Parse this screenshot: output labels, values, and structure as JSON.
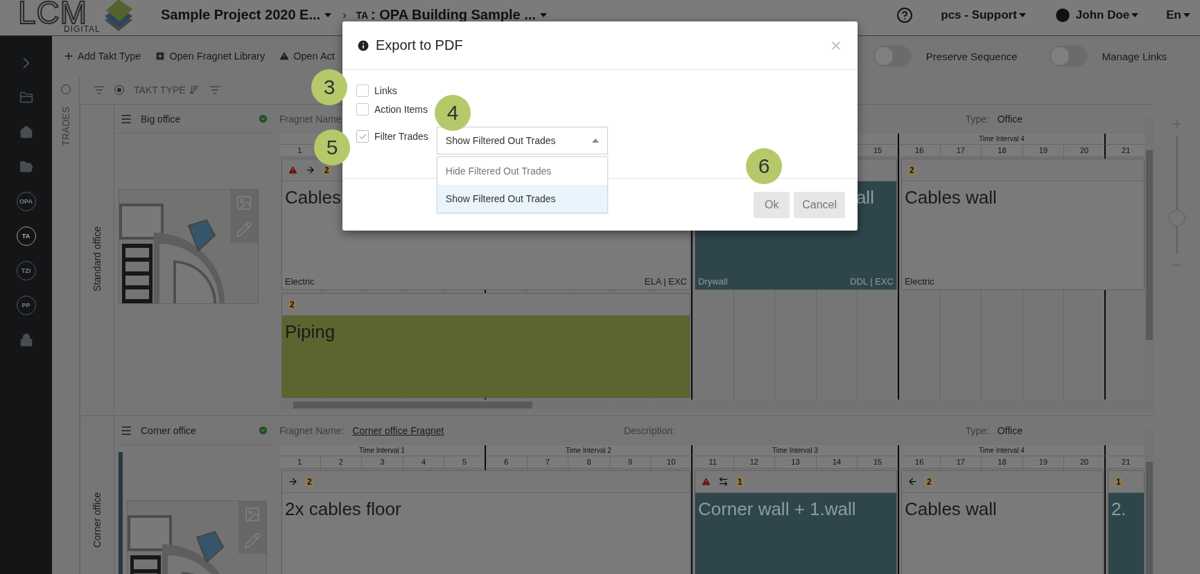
{
  "topbar": {
    "logo": {
      "text": "LCM",
      "subtext": "DIGITAL"
    },
    "project": "Sample Project 2020 E...",
    "separator": "›",
    "area_prefix": "TA",
    "area": ": OPA Building Sample ...",
    "account": "pcs - Support",
    "user": "John Doe",
    "language": "En"
  },
  "sidebar": {
    "items": [
      {
        "kind": "expand",
        "selected": false
      },
      {
        "kind": "folder",
        "selected": false
      },
      {
        "kind": "home",
        "selected": false
      },
      {
        "kind": "open-folder",
        "selected": false
      },
      {
        "kind": "badge",
        "label": "OPA",
        "selected": false
      },
      {
        "kind": "badge",
        "label": "TA",
        "selected": true
      },
      {
        "kind": "badge",
        "label": "TZI",
        "selected": false
      },
      {
        "kind": "badge",
        "label": "PP",
        "selected": false
      },
      {
        "kind": "lock",
        "selected": false
      }
    ]
  },
  "toolbar": {
    "actions": [
      {
        "kind": "add",
        "label": "Add Takt Type"
      },
      {
        "kind": "library",
        "label": "Open Fragnet Library"
      },
      {
        "kind": "warning",
        "label": "Open Act"
      }
    ],
    "toggles": [
      {
        "label": "Preserve Sequence",
        "on": false
      },
      {
        "label": "Manage Links",
        "on": false
      }
    ]
  },
  "trades_panel": {
    "label": "TRADES",
    "selected": false
  },
  "filter_row": {
    "label": "TAKT TYPE",
    "selected": true
  },
  "sections": [
    {
      "label": "Standard office",
      "name": "Big office",
      "done": true,
      "fragnet_label": "Fragnet Name",
      "type_label": "Type:",
      "type": "Office",
      "intervals": [
        "Time Interval 4"
      ],
      "columns": [
        "1",
        "15",
        "16",
        "17",
        "18",
        "19",
        "20",
        "21"
      ],
      "lanes": [
        [
          {
            "color": "#7a7a7a",
            "flags": [
              {
                "kind": "warning"
              },
              {
                "kind": "arrow-right"
              }
            ],
            "count": "2",
            "title": "Cables",
            "trade": "Electric",
            "code": "ELA | EXC"
          },
          {
            "color": "#2f454c",
            "title": "all",
            "cut": true,
            "trade": "Drywall",
            "code": "DDL | EXC"
          },
          {
            "color": "#7a7a7a",
            "count": "2",
            "title": "Cables wall",
            "trade": "Electric"
          }
        ],
        [
          {
            "color": "#5a6530",
            "count": "2",
            "title": "Piping"
          }
        ]
      ]
    },
    {
      "label": "Corner office",
      "name": "Corner office",
      "done": true,
      "fragnet_label": "Fragnet Name:",
      "fragnet": "Corner office Fragnet",
      "description_label": "Description:",
      "type_label": "Type:",
      "type": "Office",
      "intervals": [
        "Time Interval 1",
        "Time Interval 2",
        "Time Interval 3",
        "Time Interval 4"
      ],
      "columns": [
        "1",
        "2",
        "3",
        "4",
        "5",
        "6",
        "7",
        "8",
        "9",
        "10",
        "11",
        "12",
        "13",
        "14",
        "15",
        "16",
        "17",
        "18",
        "19",
        "20",
        "21"
      ],
      "lanes": [
        [
          {
            "color": "#7a7a7a",
            "flags": [
              {
                "kind": "arrow-right"
              }
            ],
            "count": "2",
            "title": "2x cables floor"
          },
          {
            "color": "#2f454c",
            "flags": [
              {
                "kind": "warning"
              },
              {
                "kind": "swap"
              }
            ],
            "count": "1",
            "title": "Corner wall + 1.wall"
          },
          {
            "color": "#7a7a7a",
            "flags": [
              {
                "kind": "arrow-left"
              }
            ],
            "count": "2",
            "title": "Cables wall"
          },
          {
            "color": "#2f454c",
            "count": "1",
            "title": "2."
          }
        ]
      ]
    }
  ],
  "zoom": {
    "level": 0.3
  },
  "dialog": {
    "title": "Export to PDF",
    "options": [
      {
        "label": "Links",
        "checked": false
      },
      {
        "label": "Action Items",
        "checked": false
      },
      {
        "label": "Filter Trades",
        "checked": true,
        "select": {
          "value": "Show Filtered Out Trades",
          "expanded": true,
          "options": [
            {
              "label": "Hide Filtered Out Trades",
              "selected": false
            },
            {
              "label": "Show Filtered Out Trades",
              "selected": true
            }
          ]
        }
      }
    ],
    "buttons": [
      {
        "label": "Ok"
      },
      {
        "label": "Cancel"
      }
    ]
  },
  "callouts": [
    "3",
    "4",
    "5",
    "6"
  ]
}
